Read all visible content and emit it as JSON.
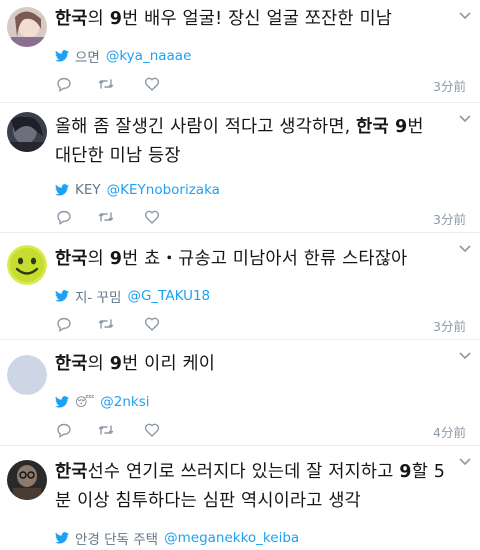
{
  "tweets": [
    {
      "text_parts": [
        {
          "t": "한국",
          "b": true
        },
        {
          "t": "의 ",
          "b": false
        },
        {
          "t": "9",
          "b": true
        },
        {
          "t": "번 배우 얼굴! 장신 얼굴 쪼잔한 미남",
          "b": false
        }
      ],
      "source_name": "으면",
      "handle": "@kya_naaae",
      "time": "3分前"
    },
    {
      "text_parts": [
        {
          "t": "올해 좀 잘생긴 사람이 적다고 생각하면, ",
          "b": false
        },
        {
          "t": "한국 9",
          "b": true
        },
        {
          "t": "번 대단한 미남 등장",
          "b": false
        }
      ],
      "source_name": "KEY",
      "handle": "@KEYnoborizaka",
      "time": "3分前"
    },
    {
      "text_parts": [
        {
          "t": "한국",
          "b": true
        },
        {
          "t": "의 ",
          "b": false
        },
        {
          "t": "9",
          "b": true
        },
        {
          "t": "번 쵸・규송고 미남아서 한류 스타잖아",
          "b": false
        }
      ],
      "source_name": "지- 꾸밈",
      "handle": "@G_TAKU18",
      "time": "3分前"
    },
    {
      "text_parts": [
        {
          "t": "한국",
          "b": true
        },
        {
          "t": "의 ",
          "b": false
        },
        {
          "t": "9",
          "b": true
        },
        {
          "t": "번 이리 케이",
          "b": false
        }
      ],
      "source_name": "😴",
      "handle": "@2nksi",
      "time": "4分前"
    },
    {
      "text_parts": [
        {
          "t": "한국",
          "b": true
        },
        {
          "t": "선수 연기로 쓰러지다 있는데 잘 저지하고 ",
          "b": false
        },
        {
          "t": "9",
          "b": true
        },
        {
          "t": "할 5분 이상 침투하다는 심판 역시이라고 생각",
          "b": false
        }
      ],
      "source_name": "안경 단독 주택",
      "handle": "@meganekko_keiba",
      "time": ""
    }
  ],
  "colors": {
    "twitter_blue": "#1da1f2",
    "muted": "#8d9aa6",
    "divider": "#e6ecf0"
  }
}
